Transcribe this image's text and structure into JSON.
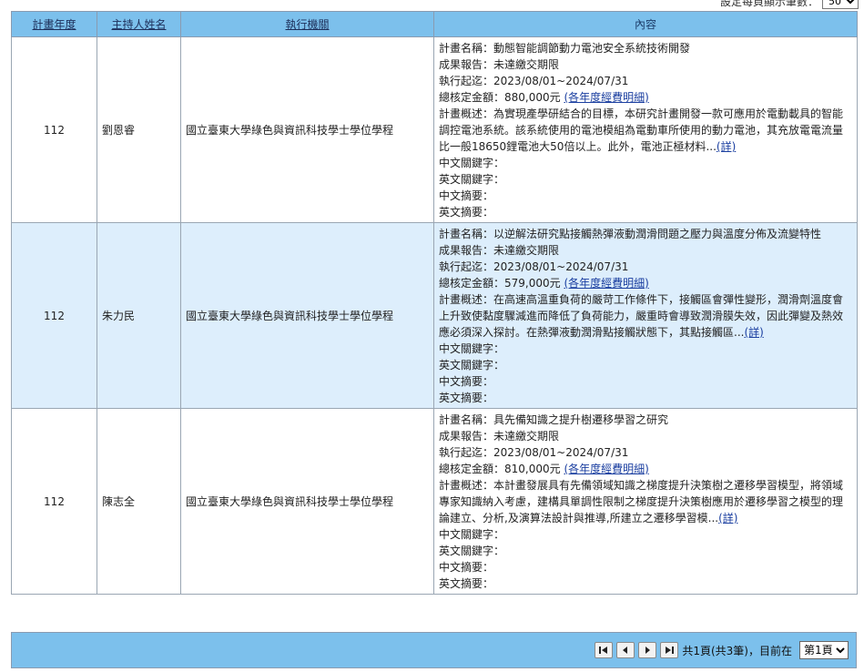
{
  "per_page": {
    "label": "設定每頁顯示筆數：",
    "value": "50"
  },
  "headers": {
    "year": "計畫年度",
    "host": "主持人姓名",
    "org": "執行機關",
    "content": "內容"
  },
  "rows": [
    {
      "year": "112",
      "host": "劉恩睿",
      "org": "國立臺東大學綠色與資訊科技學士學位學程",
      "plan_name": "計畫名稱：動態智能調節動力電池安全系統技術開發",
      "report": "成果報告：未達繳交期限",
      "period": "執行起迄：2023/08/01~2024/07/31",
      "amount": "總核定金額：880,000元",
      "amount_link": "(各年度經費明細)",
      "summary": "計畫概述：為實現產學研結合的目標，本研究計畫開發一款可應用於電動載具的智能調控電池系統。該系統使用的電池模組為電動車所使用的動力電池，其充放電電流量比一般18650鋰電池大50倍以上。此外，電池正極材料...",
      "more": "(詳)",
      "kw_zh": "中文關鍵字：",
      "kw_en": "英文關鍵字：",
      "abs_zh": "中文摘要：",
      "abs_en": "英文摘要："
    },
    {
      "year": "112",
      "host": "朱力民",
      "org": "國立臺東大學綠色與資訊科技學士學位學程",
      "plan_name": "計畫名稱：以逆解法研究點接觸熱彈液動潤滑問題之壓力與溫度分佈及流變特性",
      "report": "成果報告：未達繳交期限",
      "period": "執行起迄：2023/08/01~2024/07/31",
      "amount": "總核定金額：579,000元",
      "amount_link": "(各年度經費明細)",
      "summary": "計畫概述：在高速高溫重負荷的嚴苛工作條件下，接觸區會彈性變形，潤滑劑溫度會上升致使黏度驟減進而降低了負荷能力，嚴重時會導致潤滑膜失效，因此彈變及熱效應必須深入探討。在熱彈液動潤滑點接觸狀態下，其點接觸區...",
      "more": "(詳)",
      "kw_zh": "中文關鍵字：",
      "kw_en": "英文關鍵字：",
      "abs_zh": "中文摘要：",
      "abs_en": "英文摘要："
    },
    {
      "year": "112",
      "host": "陳志全",
      "org": "國立臺東大學綠色與資訊科技學士學位學程",
      "plan_name": "計畫名稱：具先備知識之提升樹遷移學習之研究",
      "report": "成果報告：未達繳交期限",
      "period": "執行起迄：2023/08/01~2024/07/31",
      "amount": "總核定金額：810,000元",
      "amount_link": "(各年度經費明細)",
      "summary": "計畫概述：本計畫發展具有先備領域知識之梯度提升決策樹之遷移學習模型，將領域專家知識納入考慮，建構具單調性限制之梯度提升決策樹應用於遷移學習之模型的理論建立、分析,及演算法設計與推導,所建立之遷移學習模...",
      "more": "(詳)",
      "kw_zh": "中文關鍵字：",
      "kw_en": "英文關鍵字：",
      "abs_zh": "中文摘要：",
      "abs_en": "英文摘要："
    }
  ],
  "pager": {
    "info": "共1頁(共3筆)，目前在",
    "page_value": "第1頁",
    "icons": [
      "first-page-icon",
      "prev-page-icon",
      "next-page-icon",
      "last-page-icon"
    ]
  },
  "colors": {
    "header_bg": "#7cc0ec",
    "alt_row_bg": "#ddeefc",
    "link": "#1b3fa0"
  }
}
